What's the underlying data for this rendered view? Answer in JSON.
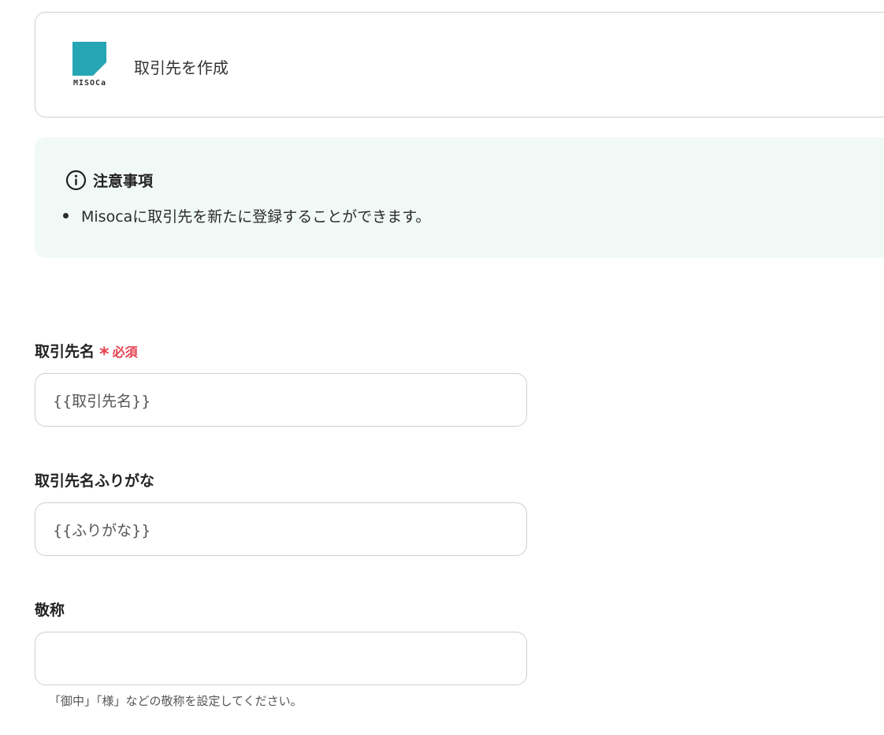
{
  "app_card": {
    "logo_text": "MISOCa",
    "title": "取引先を作成",
    "brand_color": "#26a6b4"
  },
  "notice": {
    "icon": "info-circle-icon",
    "title": "注意事項",
    "items": [
      "Misocaに取引先を新たに登録することができます。"
    ],
    "background": "#f1f9f7"
  },
  "form": {
    "fields": [
      {
        "label": "取引先名",
        "required_mark": "*",
        "required_text": "必須",
        "value": "{{取引先名}}"
      },
      {
        "label": "取引先名ふりがな",
        "value": "{{ふりがな}}"
      },
      {
        "label": "敬称",
        "value": "",
        "help": "「御中」「様」などの敬称を設定してください。"
      }
    ],
    "required_color": "#e5414f"
  }
}
